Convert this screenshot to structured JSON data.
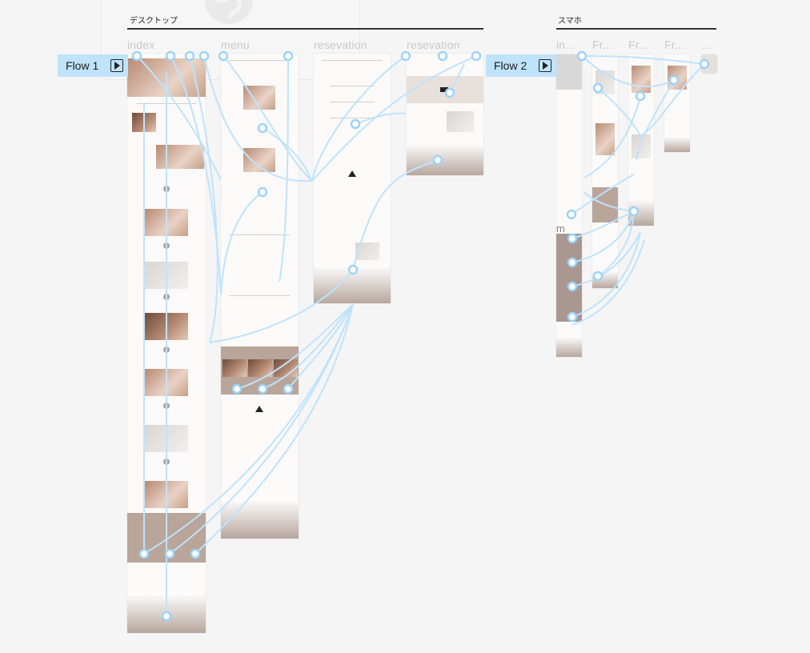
{
  "sections": {
    "desktop": "デスクトップ",
    "mobile": "スマホ"
  },
  "frames": {
    "index": "index",
    "menu": "menu",
    "reservation1": "resevation",
    "reservation2": "resevation",
    "sp1": "in...",
    "sp2": "Fr...",
    "sp3": "Fr...",
    "sp4": "Fr...",
    "sp5": "...",
    "sp_partial": "m"
  },
  "flows": {
    "flow1": "Flow 1",
    "flow2": "Flow 2"
  },
  "icons": {
    "flow_start": "play-icon",
    "ghost": "globe-icon"
  },
  "colors": {
    "canvas": "#f5f5f5",
    "connector": "#bfe3fb",
    "flow_tag": "#bfe3fb",
    "accent_band": "#b9a59a"
  }
}
